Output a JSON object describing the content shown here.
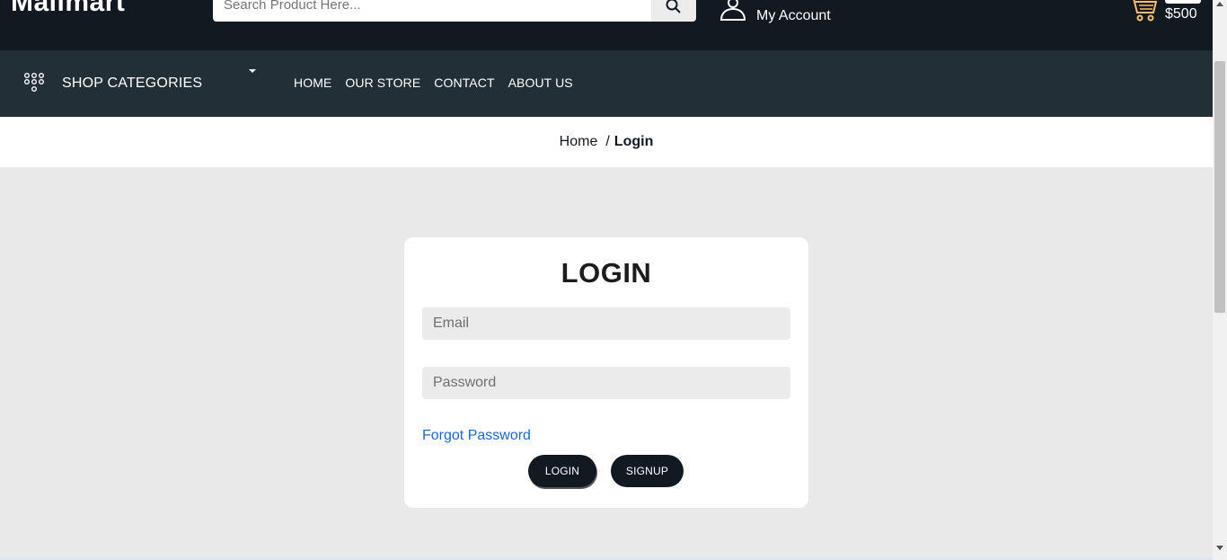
{
  "header": {
    "brand": "Mallmart",
    "search": {
      "placeholder": "Search Product Here...",
      "icon": "search-icon"
    },
    "account": {
      "label": "My Account",
      "icon": "user-icon"
    },
    "cart": {
      "total": "$500",
      "icon": "cart-icon"
    }
  },
  "nav": {
    "categories_label": "SHOP CATEGORIES",
    "links": [
      "HOME",
      "OUR STORE",
      "CONTACT",
      "ABOUT US"
    ]
  },
  "breadcrumb": {
    "home": "Home",
    "separator": "/",
    "current": "Login"
  },
  "login": {
    "title": "LOGIN",
    "email_placeholder": "Email",
    "password_placeholder": "Password",
    "forgot_label": "Forgot Password",
    "login_button": "LOGIN",
    "signup_button": "SIGNUP"
  },
  "colors": {
    "header_bg": "#131921",
    "nav_bg": "#232f36",
    "page_bg": "#e9e9e9",
    "link_blue": "#1a66d6",
    "cart_accent": "#febd69"
  }
}
